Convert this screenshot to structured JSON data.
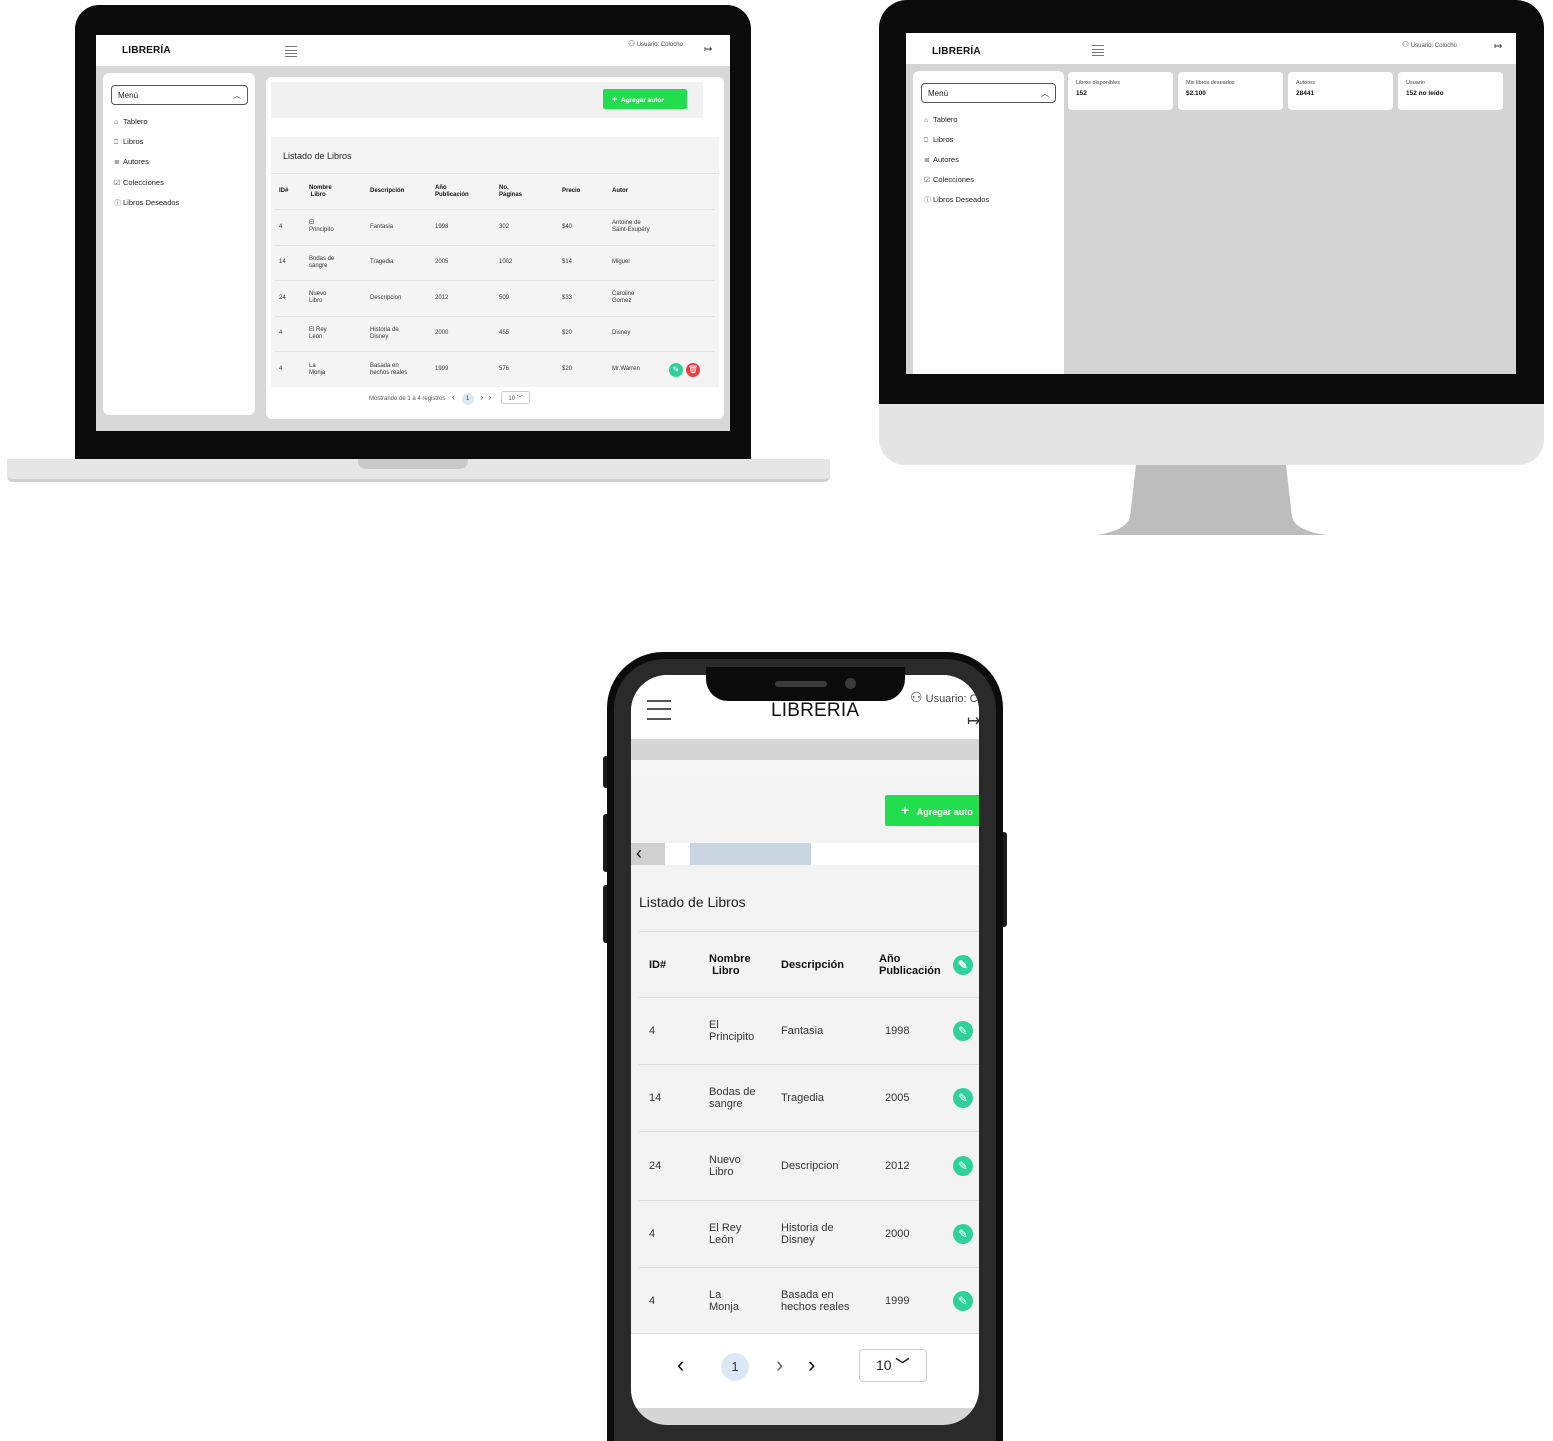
{
  "brand": "LIBRERÍA",
  "brand_mobile": "LIBRERIA",
  "user_label": "Usuario: Colocho",
  "user_label_mobile": "Usuario: C",
  "icons": {
    "hamburger": "menu-icon",
    "user": "user-icon",
    "logout": "logout-icon",
    "home": "home-icon",
    "bookmark": "bookmark-icon",
    "authors": "authors-icon",
    "collections": "check-square-icon",
    "wishlist": "info-circle-icon",
    "edit": "pencil-icon",
    "delete": "trash-icon",
    "plus": "plus-icon",
    "chevron_up": "chevron-up-icon",
    "chevron_down": "chevron-down-icon",
    "chevron_left": "chevron-left-icon",
    "chevron_right": "chevron-right-icon"
  },
  "colors": {
    "green": "#22dd4d",
    "edit": "#2fd19a",
    "delete": "#ee3c3c",
    "page_bg": "#d8d8d8"
  },
  "sidebar": {
    "menu_label": "Menú",
    "items": [
      {
        "label": "Tablero"
      },
      {
        "label": "Libros"
      },
      {
        "label": "Autores"
      },
      {
        "label": "Colecciones"
      },
      {
        "label": "Libros Deseados"
      }
    ]
  },
  "actions": {
    "add_author": "Agregar autor",
    "add_author_mobile": "Agregar auto"
  },
  "table": {
    "title": "Listado de Libros",
    "headers": {
      "id": "ID#",
      "name_1": "Nombre",
      "name_2": "Libro",
      "desc": "Descripción",
      "year_1": "Año",
      "year_2": "Publicación",
      "pages_1": "No.",
      "pages_2": "Páginas",
      "price": "Precio",
      "author": "Autor"
    },
    "rows": [
      {
        "id": "4",
        "name_1": "El",
        "name_2": "Principito",
        "desc_1": "Fantasia",
        "desc_2": "",
        "year": "1998",
        "pages": "302",
        "price": "$40",
        "author_1": "Antoine de",
        "author_2": "Saint-Exupéry"
      },
      {
        "id": "14",
        "name_1": "Bodas de",
        "name_2": "sangre",
        "desc_1": "Tragedia",
        "desc_2": "",
        "year": "2005",
        "pages": "1002",
        "price": "$14",
        "author_1": "Miguel",
        "author_2": ""
      },
      {
        "id": "24",
        "name_1": "Nuevo",
        "name_2": "Libro",
        "desc_1": "Descripcion",
        "desc_2": "",
        "year": "2012",
        "pages": "509",
        "price": "$33",
        "author_1": "Caroline",
        "author_2": "Gomez"
      },
      {
        "id": "4",
        "name_1": "El Rey",
        "name_2": "León",
        "desc_1": "Historia de",
        "desc_2": "Disney",
        "year": "2000",
        "pages": "455",
        "price": "$20",
        "author_1": "Disney",
        "author_2": ""
      },
      {
        "id": "4",
        "name_1": "La",
        "name_2": "Monja",
        "desc_1": "Basada en",
        "desc_2": "hechos reales",
        "year": "1999",
        "pages": "576",
        "price": "$20",
        "author_1": "Mr.Warren",
        "author_2": ""
      }
    ],
    "mobile_desc": [
      "Fantasia",
      "Tragedia",
      "Descripcion",
      "Historia de Disney",
      "Basada en hechos reales"
    ]
  },
  "pagination": {
    "summary": "Mostrando de 1 a 4 registros",
    "current_page": "1",
    "page_size": "10",
    "prev": "‹",
    "next": "›",
    "last": "»"
  },
  "stats": [
    {
      "label": "Libros disponibles",
      "value": "152"
    },
    {
      "label": "Mis libros deseados",
      "value": "$2.100"
    },
    {
      "label": "Autores",
      "value": "28441"
    },
    {
      "label": "Usuario",
      "value": "152 no leído"
    }
  ]
}
